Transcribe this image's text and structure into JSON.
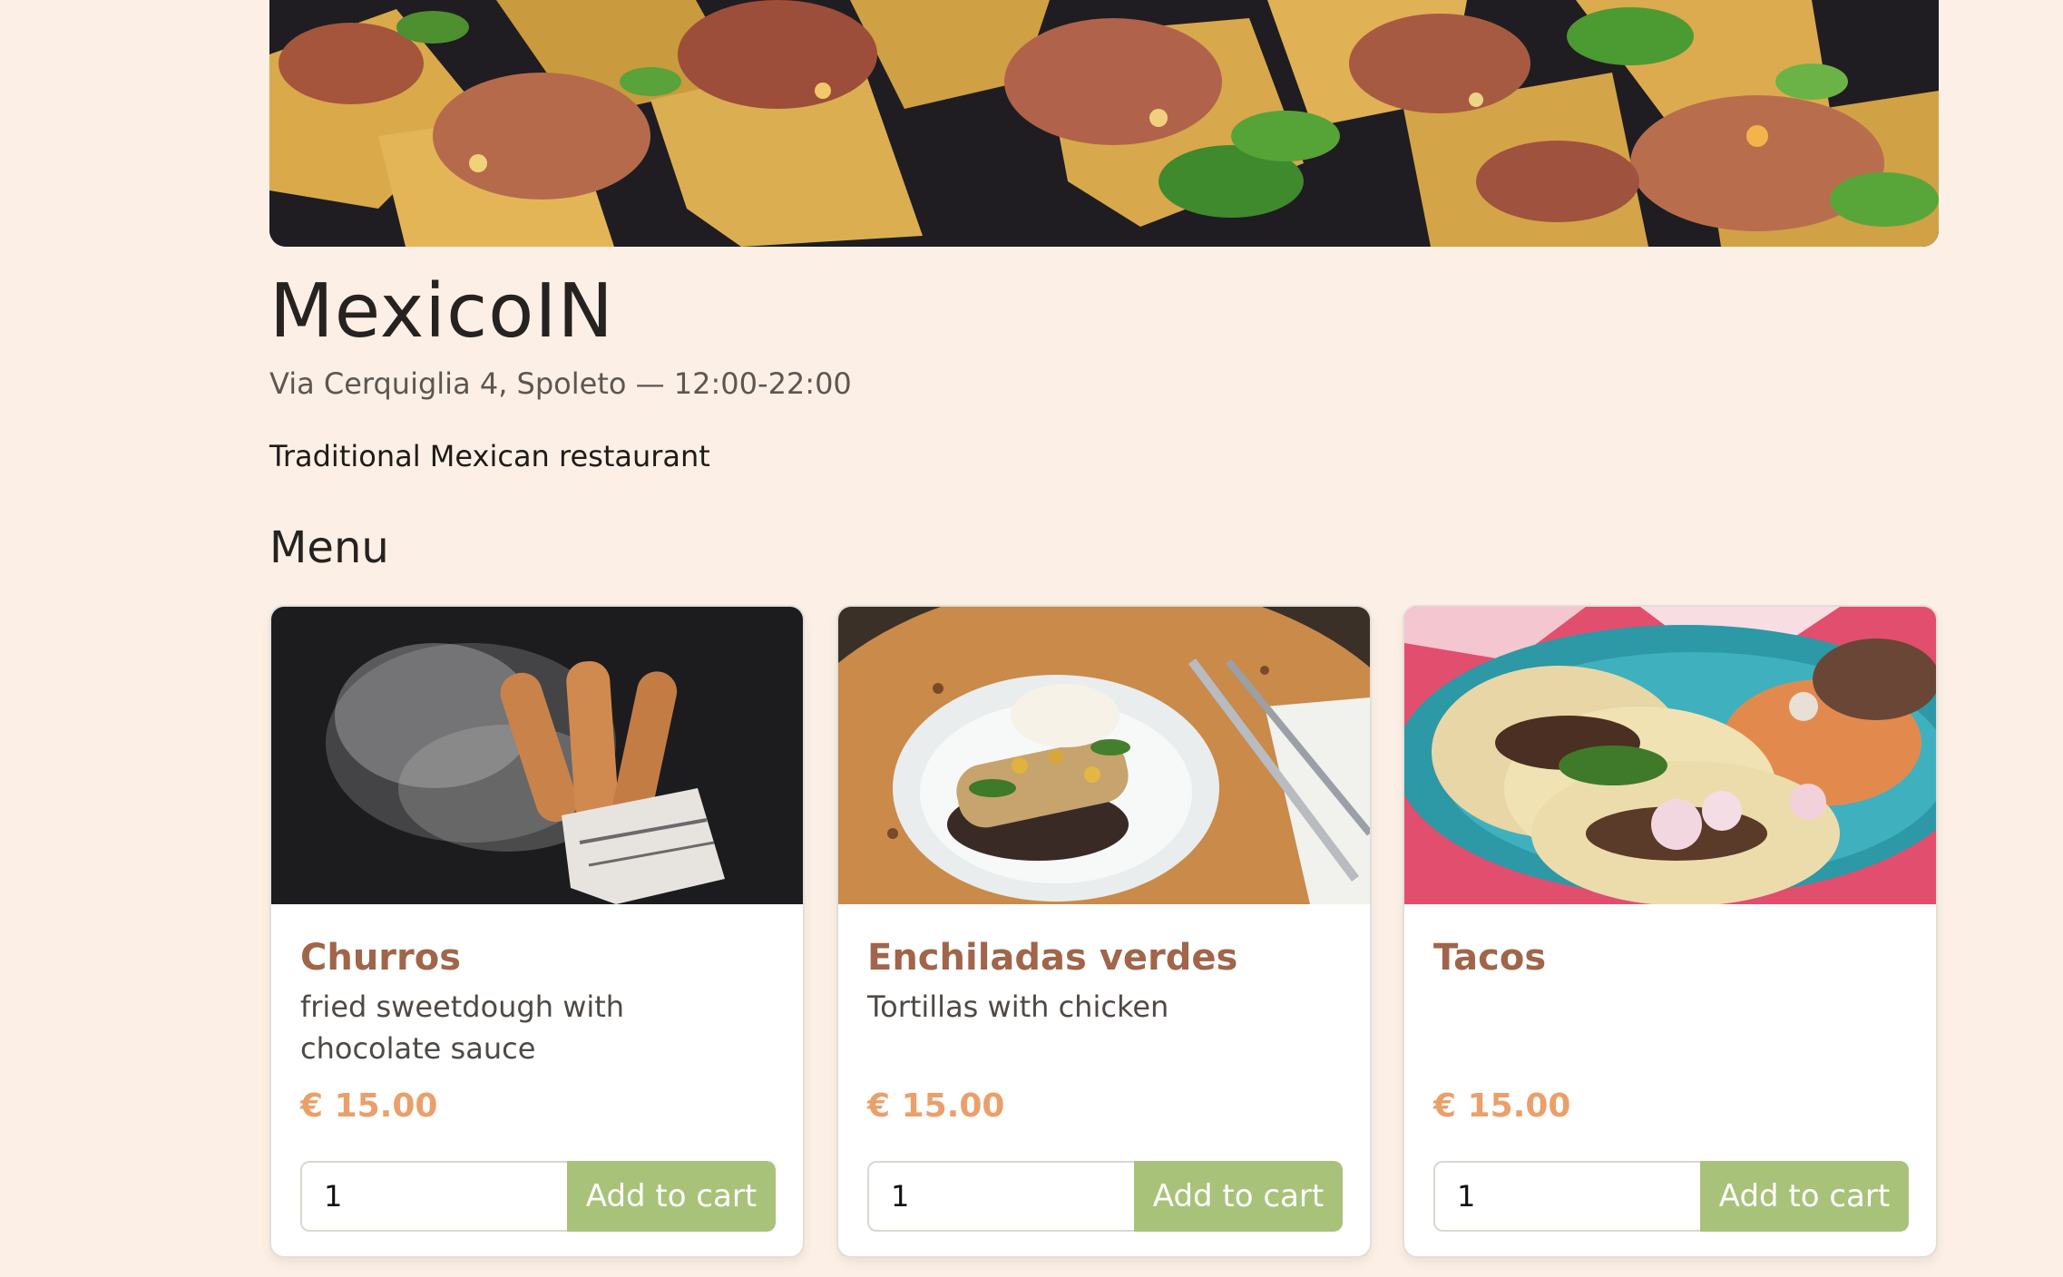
{
  "restaurant": {
    "name": "MexicoIN",
    "address_hours": "Via Cerquiglia 4, Spoleto — 12:00-22:00",
    "description": "Traditional Mexican restaurant"
  },
  "menu": {
    "heading": "Menu",
    "items": [
      {
        "name": "Churros",
        "description": "fried sweetdough with chocolate sauce",
        "price": "€ 15.00",
        "quantity": "1",
        "button_label": "Add to cart"
      },
      {
        "name": "Enchiladas verdes",
        "description": "Tortillas with chicken",
        "price": "€ 15.00",
        "quantity": "1",
        "button_label": "Add to cart"
      },
      {
        "name": "Tacos",
        "description": "",
        "price": "€ 15.00",
        "quantity": "1",
        "button_label": "Add to cart"
      }
    ]
  },
  "colors": {
    "page_background": "#fcf0e6",
    "dish_name": "#a0654a",
    "price": "#eaa06a",
    "button": "#a9c27a"
  }
}
